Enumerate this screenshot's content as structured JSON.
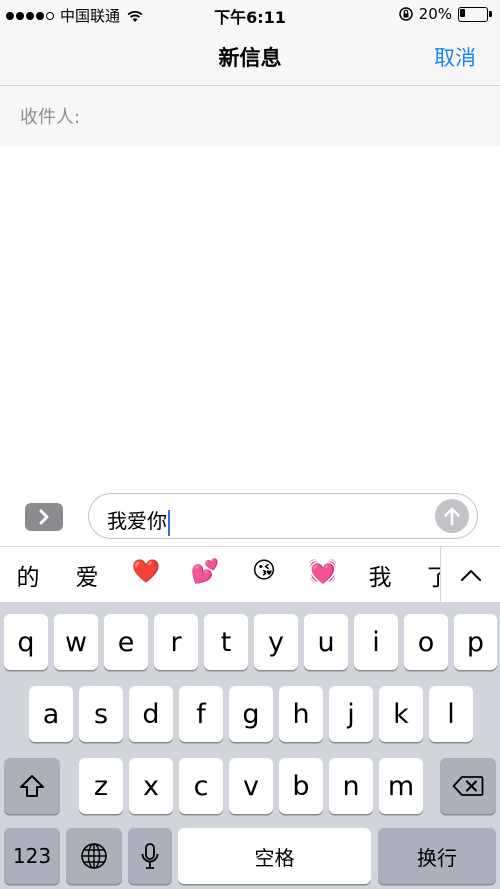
{
  "status_bar": {
    "carrier": "中国联通",
    "time": "下午6:11",
    "battery": "20%",
    "battery_level": 0.2
  },
  "nav": {
    "title": "新信息",
    "cancel_label": "取消"
  },
  "recipient": {
    "label": "收件人:"
  },
  "composer": {
    "text": "我爱你"
  },
  "candidates": [
    "的",
    "爱",
    "❤️",
    "💕",
    "😘",
    "💓",
    "我",
    "了"
  ],
  "keyboard": {
    "row1": [
      "q",
      "w",
      "e",
      "r",
      "t",
      "y",
      "u",
      "i",
      "o",
      "p"
    ],
    "row2": [
      "a",
      "s",
      "d",
      "f",
      "g",
      "h",
      "j",
      "k",
      "l"
    ],
    "row3": [
      "z",
      "x",
      "c",
      "v",
      "b",
      "n",
      "m"
    ],
    "numbers_label": "123",
    "space_label": "空格",
    "return_label": "换行"
  },
  "colors": {
    "accent": "#1a82fb",
    "caret": "#2c6fe8",
    "keyboard_bg": "#d1d4da"
  }
}
